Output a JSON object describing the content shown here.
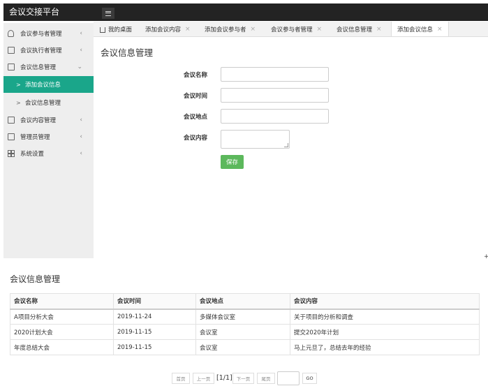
{
  "app": {
    "title": "会议交接平台"
  },
  "sidebar": {
    "items": [
      {
        "label": "会议参与者管理",
        "icon": "user-icon",
        "chevron": "‹"
      },
      {
        "label": "会议执行者管理",
        "icon": "doc-icon",
        "chevron": "‹"
      },
      {
        "label": "会议信息管理",
        "icon": "doc-icon",
        "chevron": "⌄"
      },
      {
        "label": "会议内容管理",
        "icon": "doc-icon",
        "chevron": "‹"
      },
      {
        "label": "管理员管理",
        "icon": "doc-icon",
        "chevron": "‹"
      },
      {
        "label": "系统设置",
        "icon": "grid-icon",
        "chevron": "‹"
      }
    ],
    "subitems": [
      {
        "label": "添加会议信息",
        "active": true
      },
      {
        "label": "会议信息管理",
        "active": false
      }
    ]
  },
  "tabs": [
    {
      "label": "我的桌面",
      "closable": false
    },
    {
      "label": "添加会议内容",
      "closable": true
    },
    {
      "label": "添加会议参与者",
      "closable": true
    },
    {
      "label": "会议参与者管理",
      "closable": true
    },
    {
      "label": "会议信息管理",
      "closable": true
    },
    {
      "label": "添加会议信息",
      "closable": true,
      "active": true
    }
  ],
  "form": {
    "title": "会议信息管理",
    "fields": [
      {
        "label": "会议名称",
        "value": ""
      },
      {
        "label": "会议时间",
        "value": ""
      },
      {
        "label": "会议地点",
        "value": ""
      },
      {
        "label": "会议内容",
        "value": ""
      }
    ],
    "save_label": "保存"
  },
  "list": {
    "title": "会议信息管理",
    "columns": [
      "会议名称",
      "会议时间",
      "会议地点",
      "会议内容"
    ],
    "rows": [
      [
        "A项目分析大会",
        "2019-11-24",
        "多媒体会议室",
        "关于项目的分析和调查"
      ],
      [
        "2020计划大会",
        "2019-11-15",
        "会议室",
        "提交2020年计划"
      ],
      [
        "年度总结大会",
        "2019-11-15",
        "会议室",
        "马上元旦了，总结去年的经验"
      ]
    ]
  },
  "pagination": {
    "first": "首页",
    "prev": "上一页",
    "info": "[1/1]",
    "next": "下一页",
    "last": "尾页",
    "page_input": "",
    "go": "GO"
  },
  "colors": {
    "accent": "#1aa68a",
    "save": "#5cb85c",
    "topbar": "#232323"
  }
}
